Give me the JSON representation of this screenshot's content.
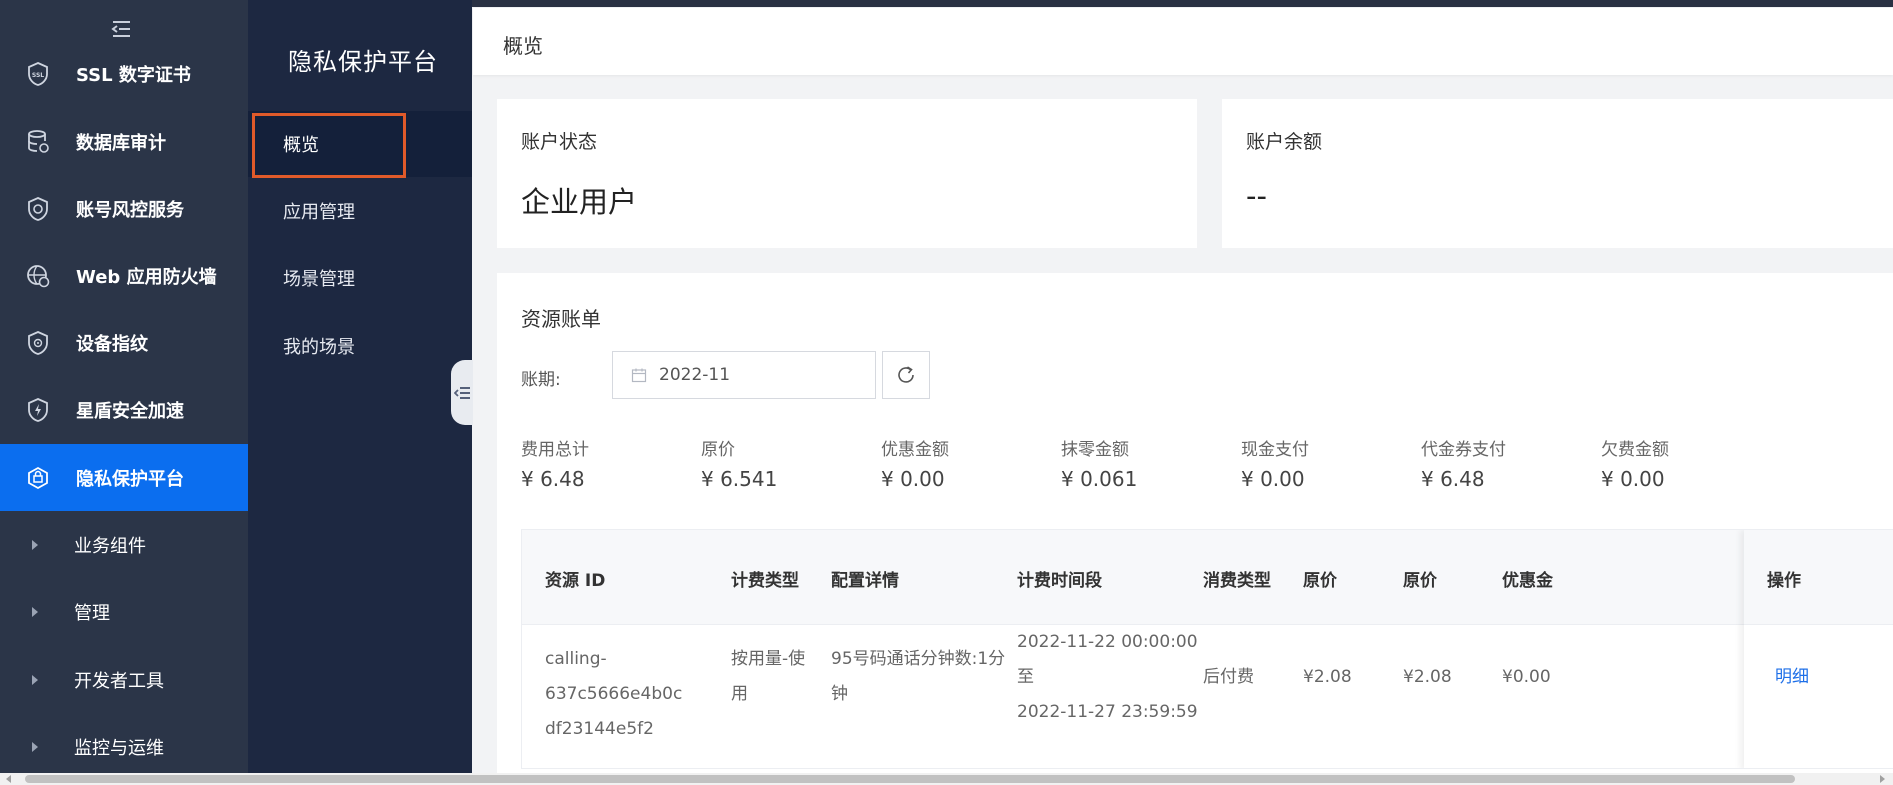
{
  "sidebar": {
    "collapse_icon": "collapse-menu-icon",
    "items": [
      {
        "label": "SSL 数字证书",
        "icon": "ssl-shield-icon"
      },
      {
        "label": "数据库审计",
        "icon": "database-icon"
      },
      {
        "label": "账号风控服务",
        "icon": "risk-shield-icon"
      },
      {
        "label": "Web 应用防火墙",
        "icon": "firewall-icon"
      },
      {
        "label": "设备指纹",
        "icon": "fingerprint-shield-icon"
      },
      {
        "label": "星盾安全加速",
        "icon": "lightning-shield-icon"
      },
      {
        "label": "隐私保护平台",
        "icon": "privacy-icon",
        "active": true
      },
      {
        "label": "业务组件"
      },
      {
        "label": "管理"
      },
      {
        "label": "开发者工具"
      },
      {
        "label": "监控与运维"
      }
    ]
  },
  "subnav": {
    "title": "隐私保护平台",
    "items": [
      "概览",
      "应用管理",
      "场景管理",
      "我的场景"
    ]
  },
  "header": {
    "breadcrumb": "概览"
  },
  "account_status": {
    "title": "账户状态",
    "value": "企业用户"
  },
  "account_balance": {
    "title": "账户余额",
    "value": "--"
  },
  "bill": {
    "title": "资源账单",
    "period_label": "账期:",
    "period_value": "2022-11",
    "stats": [
      {
        "label": "费用总计",
        "value": "¥ 6.48"
      },
      {
        "label": "原价",
        "value": "¥ 6.541"
      },
      {
        "label": "优惠金额",
        "value": "¥ 0.00"
      },
      {
        "label": "抹零金额",
        "value": "¥ 0.061"
      },
      {
        "label": "现金支付",
        "value": "¥ 0.00"
      },
      {
        "label": "代金券支付",
        "value": "¥ 6.48"
      },
      {
        "label": "欠费金额",
        "value": "¥ 0.00"
      }
    ],
    "columns": [
      "资源 ID",
      "计费类型",
      "配置详情",
      "计费时间段",
      "消费类型",
      "原价",
      "原价",
      "优惠金",
      "操作"
    ],
    "row": {
      "resource_id_1": "calling-637c5666e4b0c",
      "resource_id_2": "df23144e5f2",
      "billing_type_1": "按用量-使",
      "billing_type_2": "用",
      "config_1": "95号码通话分钟数:1分",
      "config_2": "钟",
      "time_start": "2022-11-22 00:00:00",
      "time_to": "至",
      "time_end": "2022-11-27 23:59:59",
      "consume_type": "后付费",
      "price1": "¥2.08",
      "price2": "¥2.08",
      "discount": "¥0.00",
      "action": "明细"
    }
  },
  "colors": {
    "active": "#0b6eef",
    "sidebar": "#2b3548",
    "subnav": "#1d2841",
    "link": "#1e6fe8",
    "highlight": "#e05a2a"
  }
}
